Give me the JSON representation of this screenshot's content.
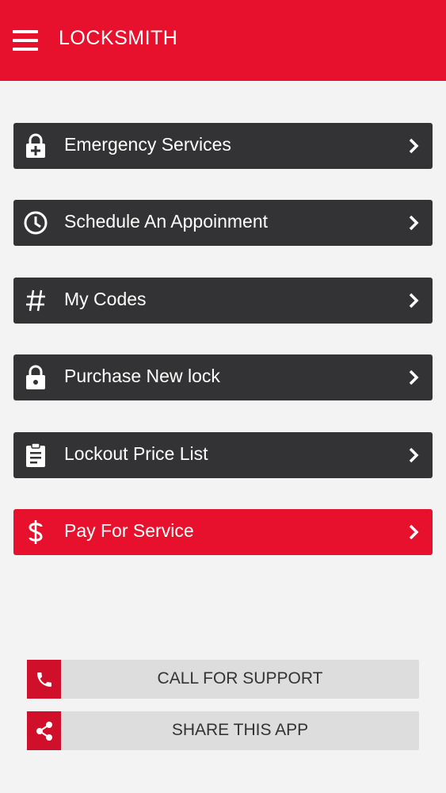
{
  "header": {
    "title": "LOCKSMITH",
    "menu_icon": "hamburger-menu-icon",
    "background": "#e8112d"
  },
  "menu": {
    "items": [
      {
        "label": "Emergency Services",
        "icon": "lock-plus-icon"
      },
      {
        "label": "Schedule An Appoinment",
        "icon": "clock-icon"
      },
      {
        "label": "My Codes",
        "icon": "hash-icon"
      },
      {
        "label": "Purchase New lock",
        "icon": "lock-icon"
      },
      {
        "label": "Lockout Price List",
        "icon": "clipboard-icon"
      },
      {
        "label": "Pay For Service",
        "icon": "dollar-icon"
      }
    ],
    "item_color": "#333335",
    "accent_color": "#e8112d"
  },
  "actions": {
    "call_label": "CALL FOR SUPPORT",
    "call_icon": "phone-icon",
    "share_label": "SHARE THIS APP",
    "share_icon": "share-icon"
  }
}
